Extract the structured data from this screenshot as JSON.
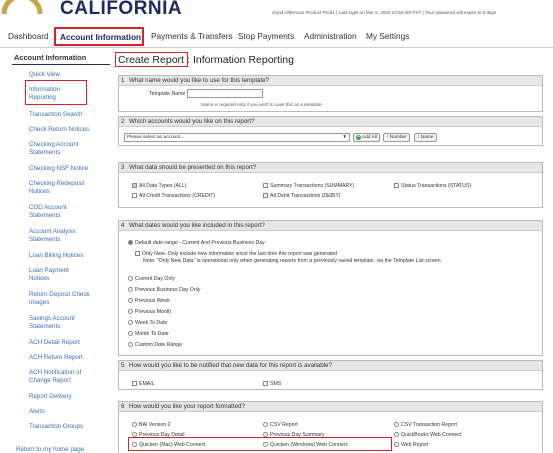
{
  "header": {
    "brand": "CALIFORNIA",
    "userbar": "Good Afternoon Product Prod1 | Last login on Mar 5, 2020 10:53 AM PST | Your password will expire in 6 days"
  },
  "nav": {
    "items": [
      "Dashboard",
      "Account Information",
      "Payments & Transfers",
      "Stop Payments",
      "Administration",
      "My Settings"
    ]
  },
  "sidebar": {
    "heading": "Account Information",
    "items": [
      "Quick View",
      "Information Reporting",
      "Transaction Search",
      "Check Return Notices",
      "Checking Account Statements",
      "Checking NSF Notice",
      "Checking Redeposit Notices",
      "COD Account Statements",
      "Account Analysis Statements",
      "Loan Billing Notices",
      "Loan Payment Notices",
      "Return Deposit Check Images",
      "Savings Account Statements",
      "ACH Detail Report",
      "ACH Return Report",
      "ACH Notification of Change Report",
      "Report Delivery",
      "Alerts",
      "Transaction Groups"
    ],
    "return_link": "Return to my home page"
  },
  "page": {
    "title_prefix": "Create Report :",
    "title_suffix": "Information Reporting"
  },
  "s1": {
    "num": "1",
    "question": "What name would you like to use for this template?",
    "label": "Template Name",
    "value": "",
    "note": "Name is required only if you wish to save this as a template."
  },
  "s2": {
    "num": "2",
    "question": "Which accounts would you like on this report?",
    "select": "Please select an account...",
    "add_all": "Add All",
    "number": "Number",
    "name": "Name"
  },
  "s3": {
    "num": "3",
    "question": "What data should be presented on this report?",
    "options": [
      "All Data Types (ALL)",
      "Summary Transactions (SUMMARY)",
      "Status Transactions (STATUS)",
      "All Credit Transactions (CREDIT)",
      "All Debit Transactions (DEBIT)"
    ]
  },
  "s4": {
    "num": "4",
    "question": "What dates would you like included in this report?",
    "default": "Default date range - Current And Previous Business Day",
    "only_new": "Only New- Only include new information since the last time this report was generated",
    "only_new_note": "Note: \"Only New Data\" is operational only when generating reports from a previously saved template, via the Template List screen.",
    "options": [
      "Current Day Only",
      "Previous Business Day Only",
      "Previous Week",
      "Previous Month",
      "Week To Date",
      "Month To Date",
      "Custom Date Range"
    ]
  },
  "s5": {
    "num": "5",
    "question": "How would you like to be notified that new data for this report is available?",
    "options": [
      "EMAIL",
      "SMS"
    ]
  },
  "s6": {
    "num": "6",
    "question": "How would you like your report formatted?",
    "col1": [
      "BAI Version 2",
      "Previous Day Detail",
      "Quicken (Mac) Web Connect"
    ],
    "col2": [
      "CSV Report",
      "Previous Day Summary",
      "Quicken (Windows) Web Connect"
    ],
    "col3": [
      "CSV Transaction Report",
      "QuickBooks Web Connect",
      "Web Report"
    ]
  },
  "colors": {
    "brand": "#1d2b63",
    "highlight": "#d8232a",
    "link": "#3a6fb0"
  }
}
